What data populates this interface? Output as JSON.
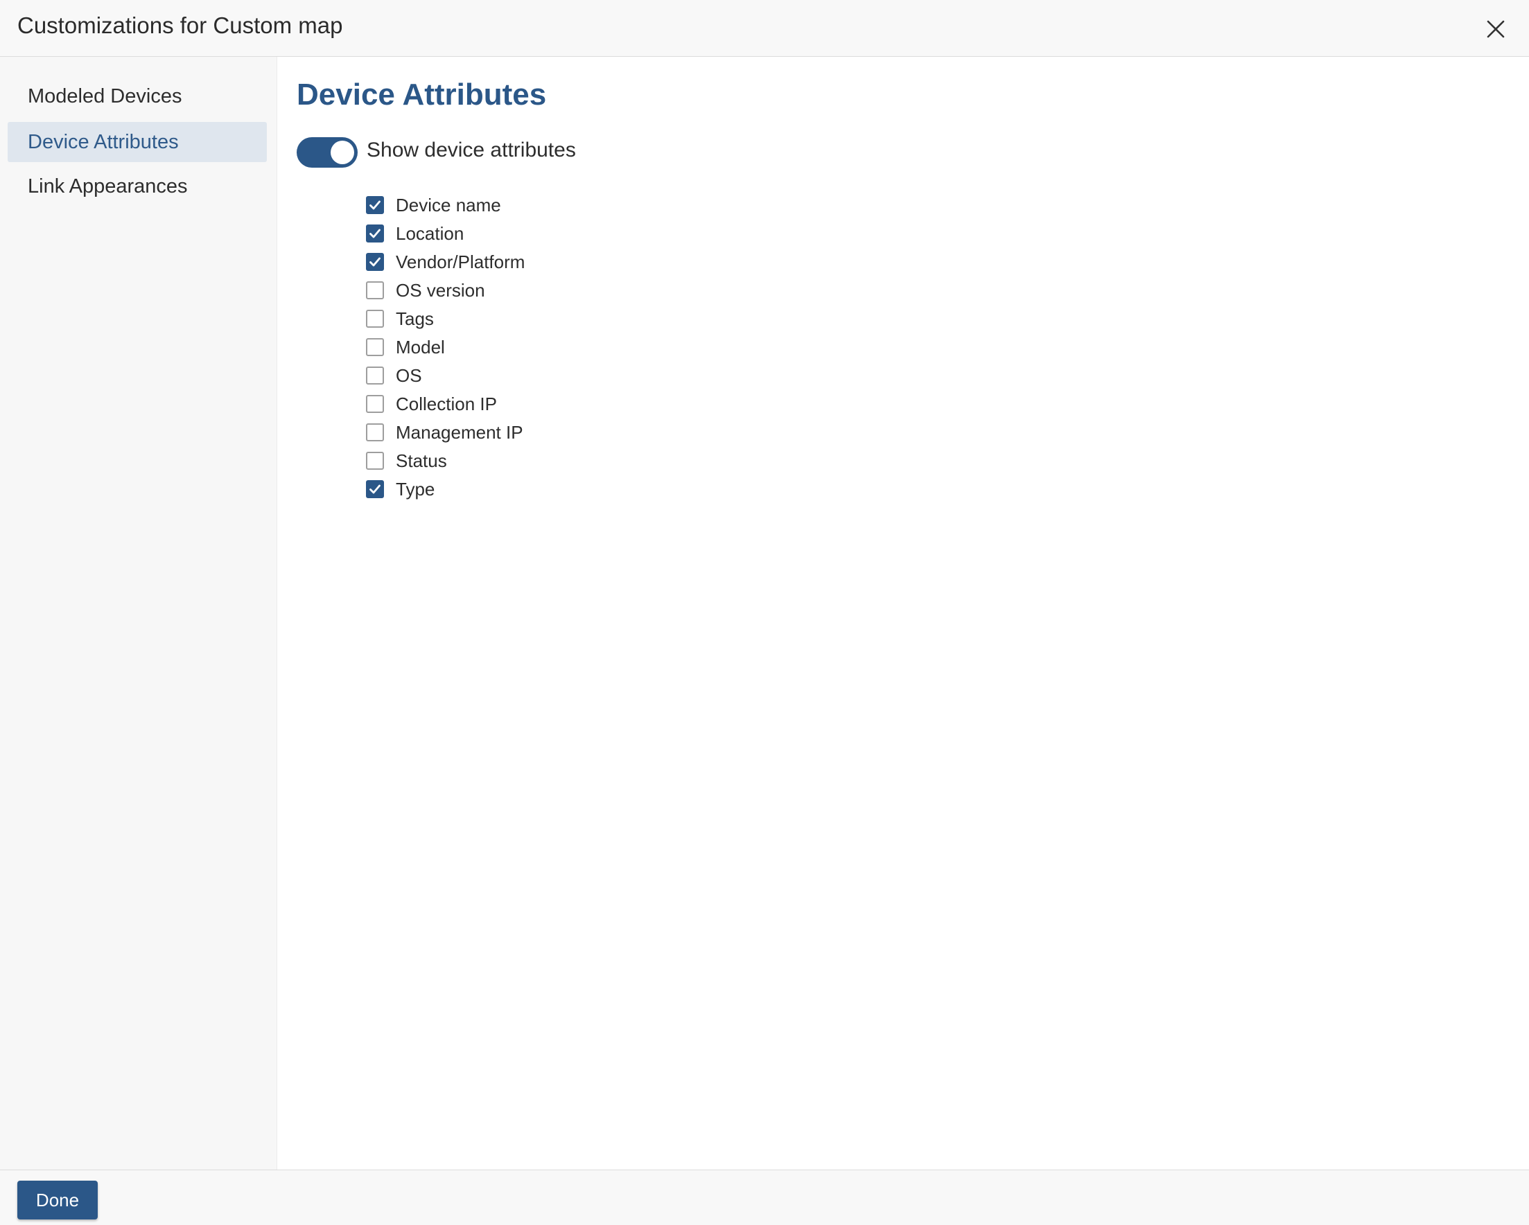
{
  "dialog": {
    "title": "Customizations for Custom map",
    "close_icon": "close-icon"
  },
  "sidebar": {
    "items": [
      {
        "label": "Modeled Devices",
        "active": false
      },
      {
        "label": "Device Attributes",
        "active": true
      },
      {
        "label": "Link Appearances",
        "active": false
      }
    ]
  },
  "main": {
    "title": "Device Attributes",
    "toggle": {
      "label": "Show device attributes",
      "on": true
    },
    "attributes": [
      {
        "label": "Device name",
        "checked": true
      },
      {
        "label": "Location",
        "checked": true
      },
      {
        "label": "Vendor/Platform",
        "checked": true
      },
      {
        "label": "OS version",
        "checked": false
      },
      {
        "label": "Tags",
        "checked": false
      },
      {
        "label": "Model",
        "checked": false
      },
      {
        "label": "OS",
        "checked": false
      },
      {
        "label": "Collection IP",
        "checked": false
      },
      {
        "label": "Management IP",
        "checked": false
      },
      {
        "label": "Status",
        "checked": false
      },
      {
        "label": "Type",
        "checked": true
      }
    ]
  },
  "footer": {
    "done_label": "Done"
  },
  "colors": {
    "accent": "#2b5788",
    "active_nav_bg": "#dfe6ee",
    "sidebar_bg": "#f7f7f7"
  }
}
